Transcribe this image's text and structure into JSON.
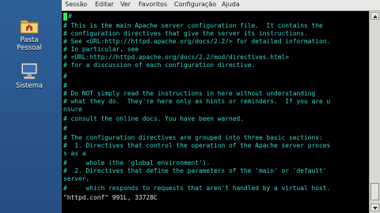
{
  "desktop": {
    "icons": [
      {
        "label_line1": "Pasta",
        "label_line2": "Pessoal",
        "icon": "home-folder-icon"
      },
      {
        "label_line1": "Sistema",
        "label_line2": "",
        "icon": "computer-icon"
      }
    ]
  },
  "menubar": {
    "items": [
      "Sessão",
      "Editar",
      "Ver",
      "Favoritos",
      "Configuração",
      "Ajuda"
    ]
  },
  "terminal": {
    "lines": [
      "#",
      "# This is the main Apache server configuration file.  It contains the",
      "# configuration directives that give the server its instructions.",
      "# See <URL:http://httpd.apache.org/docs/2.2/> for detailed information.",
      "# In particular, see",
      "# <URL:http://httpd.apache.org/docs/2.2/mod/directives.html>",
      "# for a discussion of each configuration directive.",
      "#",
      "#",
      "# Do NOT simply read the instructions in here without understanding",
      "# what they do.  They're here only as hints or reminders.  If you are u",
      "nsure",
      "# consult the online docs. You have been warned.",
      "#",
      "# The configuration directives are grouped into three basic sections:",
      "#  1. Directives that control the operation of the Apache server proces",
      "s as a",
      "#     whole (the 'global environment').",
      "#  2. Directives that define the parameters of the 'main' or 'default'",
      "server,",
      "#     which responds to requests that aren't handled by a virtual host.",
      "\"httpd.conf\" 991L, 33728C"
    ],
    "colors": {
      "comment": "#39d6c9",
      "status": "#e9e9e9",
      "cursor": "#3ee06a"
    }
  }
}
